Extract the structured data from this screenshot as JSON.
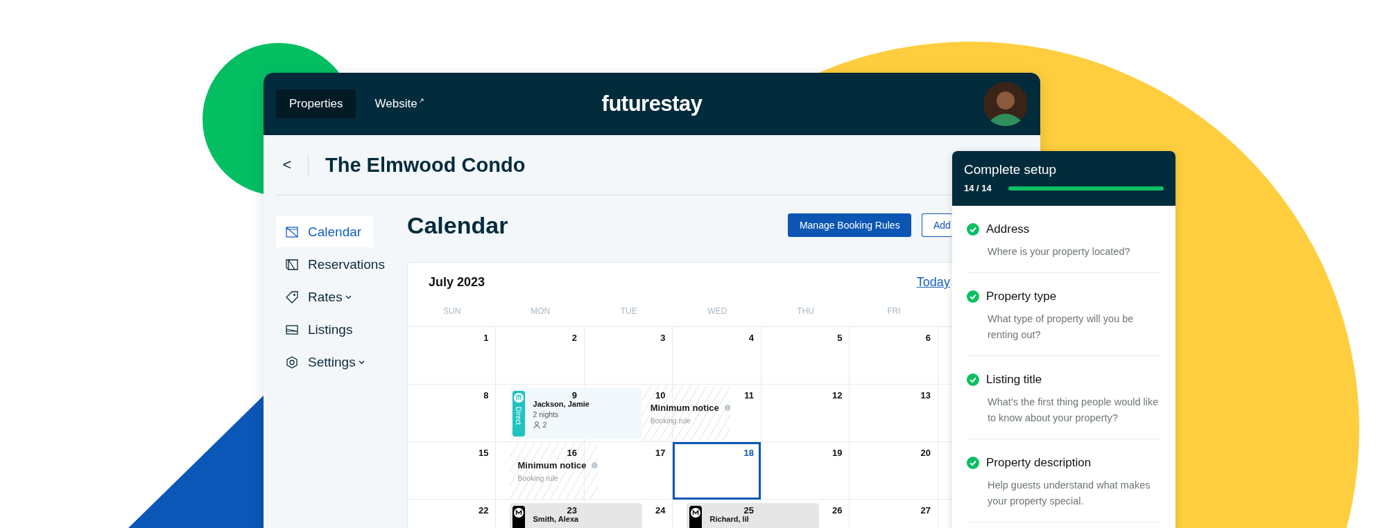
{
  "nav": {
    "tabs": [
      {
        "label": "Properties",
        "selected": true,
        "external": false
      },
      {
        "label": "Website",
        "selected": false,
        "external": true
      }
    ],
    "logo": "futurestay"
  },
  "property": {
    "back": "<",
    "title": "The Elmwood Condo"
  },
  "sidebar": {
    "items": [
      {
        "label": "Calendar",
        "selected": true,
        "dropdown": false
      },
      {
        "label": "Reservations",
        "selected": false,
        "dropdown": false
      },
      {
        "label": "Rates",
        "selected": false,
        "dropdown": true
      },
      {
        "label": "Listings",
        "selected": false,
        "dropdown": false
      },
      {
        "label": "Settings",
        "selected": false,
        "dropdown": true
      }
    ]
  },
  "page": {
    "title": "Calendar",
    "buttons": [
      {
        "label": "Manage Booking Rules",
        "kind": "primary"
      },
      {
        "label": "Add",
        "kind": "outline"
      }
    ]
  },
  "calendar": {
    "month": "July 2023",
    "today": "Today",
    "weekdays": [
      "SUN",
      "MON",
      "TUE",
      "WED",
      "THU",
      "FRI"
    ],
    "weeks": [
      {
        "days": [
          {
            "date": "1",
            "selected": false
          },
          {
            "date": "2",
            "selected": false
          },
          {
            "date": "3",
            "selected": false
          },
          {
            "date": "4",
            "selected": false
          },
          {
            "date": "5",
            "selected": false
          },
          {
            "date": "6",
            "selected": false
          }
        ]
      },
      {
        "days": [
          {
            "date": "8",
            "selected": false
          },
          {
            "date": "9",
            "selected": false,
            "event": {
              "kind": "booking",
              "color": "#1fc4c0",
              "channel_label": "Direct",
              "guest": "Jackson, Jamie",
              "nights": "2 nights",
              "guests": "2"
            }
          },
          {
            "date": "10",
            "selected": false,
            "event": {
              "kind": "rule",
              "title": "Minimum notice",
              "subtitle": "Booking rule"
            }
          },
          {
            "date": "11",
            "selected": false
          },
          {
            "date": "12",
            "selected": false
          },
          {
            "date": "13",
            "selected": false
          }
        ]
      },
      {
        "days": [
          {
            "date": "15",
            "selected": false
          },
          {
            "date": "16",
            "selected": false,
            "event": {
              "kind": "rule",
              "title": "Minimum notice",
              "subtitle": "Booking rule"
            }
          },
          {
            "date": "17",
            "selected": false
          },
          {
            "date": "18",
            "selected": true
          },
          {
            "date": "19",
            "selected": false
          },
          {
            "date": "20",
            "selected": false
          }
        ]
      },
      {
        "days": [
          {
            "date": "22",
            "selected": false
          },
          {
            "date": "23",
            "selected": false,
            "event": {
              "kind": "booking",
              "color": "#000000",
              "guest": "Smith, Alexa"
            }
          },
          {
            "date": "24",
            "selected": false
          },
          {
            "date": "25",
            "selected": false,
            "event": {
              "kind": "booking",
              "color": "#000000",
              "guest": "Richard, lil"
            }
          },
          {
            "date": "26",
            "selected": false
          },
          {
            "date": "27",
            "selected": false
          }
        ]
      }
    ]
  },
  "setup": {
    "title": "Complete setup",
    "count": "14 / 14",
    "level": 1,
    "steps": [
      {
        "title": "Address",
        "description": "Where is your property located?",
        "done": true
      },
      {
        "title": "Property type",
        "description": "What type of property will you be renting out?",
        "done": true
      },
      {
        "title": "Listing title",
        "description": "What’s the first thing people would like to know about your property?",
        "done": true
      },
      {
        "title": "Property description",
        "description": "Help guests understand what makes your property special.",
        "done": true
      }
    ]
  }
}
